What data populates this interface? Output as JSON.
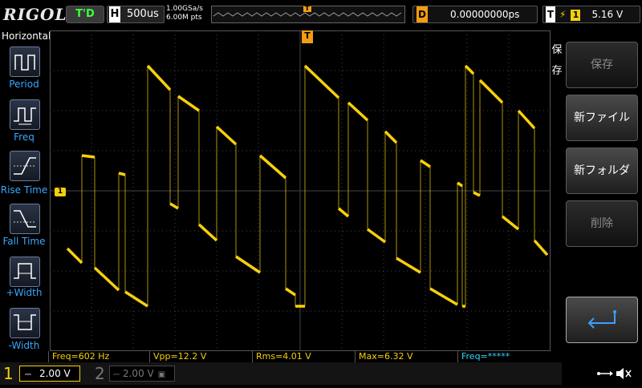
{
  "brand": "RIGOL",
  "status": "T'D",
  "timebase": {
    "label": "H",
    "value": "500us"
  },
  "sampling": {
    "rate": "1.00GSa/s",
    "points": "6.00M pts"
  },
  "trigger_marker": "T",
  "delay": {
    "label": "D",
    "value": "0.00000000ps"
  },
  "trigger": {
    "label": "T",
    "slope_icon": "rising-edge-icon",
    "source": "1",
    "level": "5.16 V"
  },
  "left_panel": {
    "title": "Horizontal",
    "items": [
      {
        "label": "Period",
        "icon": "period-icon"
      },
      {
        "label": "Freq",
        "icon": "frequency-icon"
      },
      {
        "label": "Rise Time",
        "icon": "rise-time-icon"
      },
      {
        "label": "Fall Time",
        "icon": "fall-time-icon"
      },
      {
        "label": "+Width",
        "icon": "positive-width-icon"
      },
      {
        "label": "-Width",
        "icon": "negative-width-icon"
      }
    ]
  },
  "channel_marker": "1",
  "side_label": "保存",
  "right_menu": {
    "save": "保存",
    "new_file": "新ファイル",
    "new_folder": "新フォルダ",
    "delete": "削除",
    "back_icon": "return-arrow-icon"
  },
  "measurements": {
    "freq": "Freq=602 Hz",
    "vpp": "Vpp=12.2 V",
    "rms": "Rms=4.01 V",
    "max": "Max=6.32 V",
    "freq2": "Freq=*****"
  },
  "channels": {
    "ch1": {
      "num": "1",
      "scale": "2.00 V"
    },
    "ch2": {
      "num": "2",
      "scale": "2.00 V"
    }
  },
  "colors": {
    "ch1": "#f7d00a",
    "menu_text": "#37a7ff",
    "status": "#3cff3c",
    "delay": "#f39c12"
  }
}
